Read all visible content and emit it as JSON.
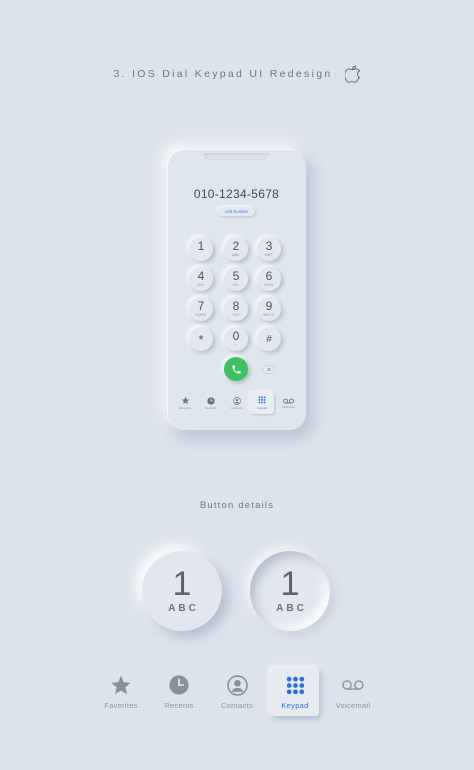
{
  "header": {
    "title": "3. IOS Dial Keypad UI Redesign",
    "logo_icon": "apple-icon"
  },
  "phone": {
    "number": "010-1234-5678",
    "add_number_label": "Add Number",
    "keys": [
      {
        "digit": "1",
        "letters": ""
      },
      {
        "digit": "2",
        "letters": "ABC"
      },
      {
        "digit": "3",
        "letters": "DEF"
      },
      {
        "digit": "4",
        "letters": "GHI"
      },
      {
        "digit": "5",
        "letters": "JKL"
      },
      {
        "digit": "6",
        "letters": "MNO"
      },
      {
        "digit": "7",
        "letters": "PQRS"
      },
      {
        "digit": "8",
        "letters": "TUV"
      },
      {
        "digit": "9",
        "letters": "WXYZ"
      },
      {
        "digit": "*",
        "letters": ""
      },
      {
        "digit": "0",
        "letters": "+"
      },
      {
        "digit": "#",
        "letters": ""
      }
    ],
    "tabs": [
      {
        "label": "Favorites",
        "icon": "star-icon"
      },
      {
        "label": "Recents",
        "icon": "clock-icon"
      },
      {
        "label": "Contacts",
        "icon": "person-icon"
      },
      {
        "label": "Keypad",
        "icon": "keypad-icon",
        "active": true
      },
      {
        "label": "Voicemail",
        "icon": "voicemail-icon"
      }
    ],
    "call_color": "#40c063",
    "accent_color": "#3b7be0"
  },
  "details": {
    "title": "Button details",
    "normal_button": {
      "digit": "1",
      "letters": "ABC"
    },
    "pressed_button": {
      "digit": "1",
      "letters": "ABC"
    }
  },
  "tabbar": {
    "tabs": [
      {
        "label": "Favorites",
        "icon": "star-icon"
      },
      {
        "label": "Recents",
        "icon": "clock-icon"
      },
      {
        "label": "Contacts",
        "icon": "person-icon"
      },
      {
        "label": "Keypad",
        "icon": "keypad-icon",
        "active": true
      },
      {
        "label": "Voicemail",
        "icon": "voicemail-icon"
      }
    ]
  }
}
